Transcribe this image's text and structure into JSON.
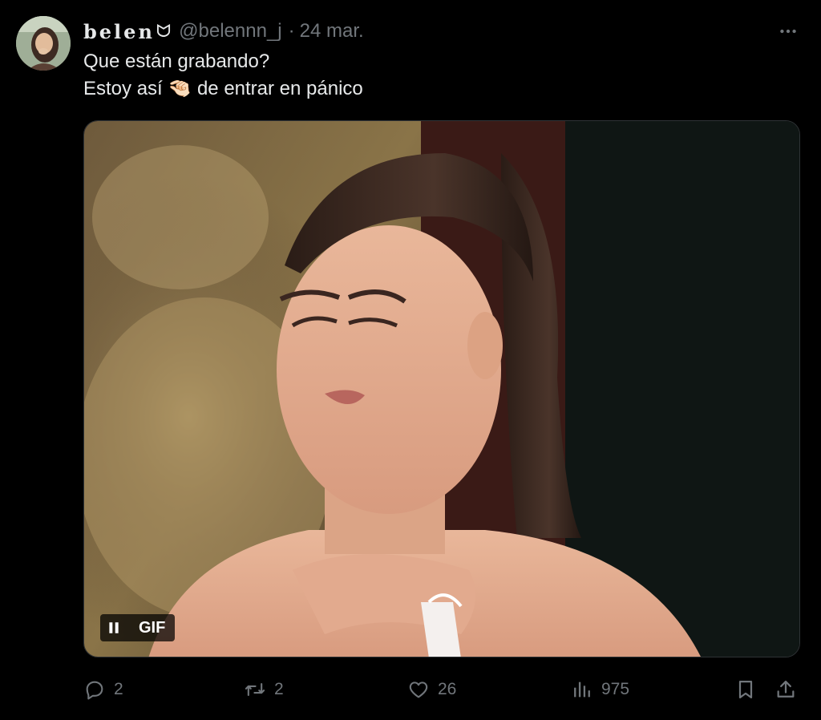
{
  "author": {
    "display_name": "belen",
    "name_glyph": "ᗢ",
    "handle": "@belennn_j",
    "separator": "·",
    "date": "24 mar."
  },
  "tweet": {
    "line1": "Que están grabando?",
    "line2_before": "Estoy así",
    "line2_emoji": "🤏🏻",
    "line2_after": "de entrar en pánico"
  },
  "media": {
    "badge_label": "GIF",
    "pause_icon": "pause-icon"
  },
  "actions": {
    "reply_count": "2",
    "retweet_count": "2",
    "like_count": "26",
    "views_count": "975"
  },
  "colors": {
    "background": "#000000",
    "text_primary": "#e7e9ea",
    "text_secondary": "#71767b",
    "border": "#2f3336"
  }
}
